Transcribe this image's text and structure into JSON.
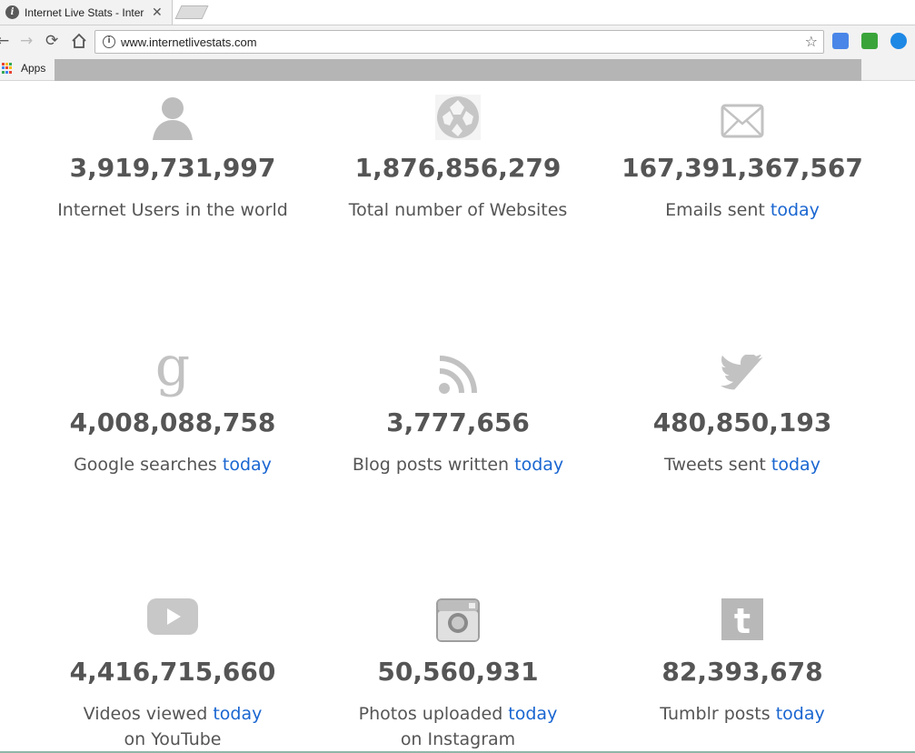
{
  "browser": {
    "tab_title": "Internet Live Stats - Intern",
    "tab_favicon": "i",
    "tab_close": "✕",
    "url": "www.internetlivestats.com",
    "bookmarks_apps_label": "Apps"
  },
  "colors": {
    "accent_link": "#1a66d1",
    "stat_text": "#555555",
    "icon_gray": "#bdbdbd"
  },
  "stats": [
    {
      "icon": "user-icon",
      "value": "3,919,731,997",
      "label": "Internet Users in the world",
      "today": "",
      "label2": ""
    },
    {
      "icon": "globe-icon",
      "value": "1,876,856,279",
      "label": "Total number of Websites",
      "today": "",
      "label2": ""
    },
    {
      "icon": "email-icon",
      "value": "167,391,367,567",
      "label": "Emails sent ",
      "today": "today",
      "label2": ""
    },
    {
      "icon": "google-icon",
      "value": "4,008,088,758",
      "label": "Google searches ",
      "today": "today",
      "label2": ""
    },
    {
      "icon": "rss-icon",
      "value": "3,777,656",
      "label": "Blog posts written ",
      "today": "today",
      "label2": ""
    },
    {
      "icon": "twitter-icon",
      "value": "480,850,193",
      "label": "Tweets sent ",
      "today": "today",
      "label2": ""
    },
    {
      "icon": "youtube-icon",
      "value": "4,416,715,660",
      "label": "Videos viewed ",
      "today": "today",
      "label2": "on YouTube"
    },
    {
      "icon": "instagram-icon",
      "value": "50,560,931",
      "label": "Photos uploaded ",
      "today": "today",
      "label2": "on Instagram"
    },
    {
      "icon": "tumblr-icon",
      "value": "82,393,678",
      "label": "Tumblr posts ",
      "today": "today",
      "label2": ""
    }
  ]
}
